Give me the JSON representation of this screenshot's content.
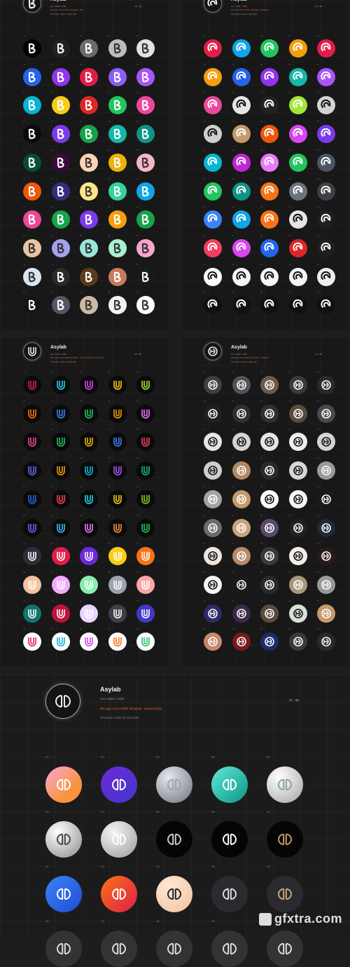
{
  "panels": [
    {
      "id": "p1",
      "title": "Asylab",
      "size": "Icon 1080 x 1080",
      "template": "30 Logo Icon Profile Template - Bix",
      "credit": "Template made by @asylab",
      "range": "01 - 50",
      "glyph": "B"
    },
    {
      "id": "p2",
      "title": "Asylab",
      "size": "Icon 1080 x 1080",
      "template": "30 Logo Icon Profile Template - Gradient",
      "credit": "Template made by @asylab",
      "range": "01 - 50",
      "glyph": "swirl"
    },
    {
      "id": "p3",
      "title": "Asylab",
      "size": "Icon 1080 x 1080",
      "template": "30 Logo Icon Profile Template - Pro & Gradient Combined",
      "credit": "Template made by @asylab",
      "range": "01 - 50",
      "glyph": "U"
    },
    {
      "id": "p4",
      "title": "Asylab",
      "size": "Icon 1080 x 1080",
      "template": "30 Logo Icon Profile Template - Gradient",
      "credit": "Template made by @asylab",
      "range": "01 - 50",
      "glyph": "circ"
    }
  ],
  "p1_colors": [
    "#000",
    "#222",
    "#6c6c6c",
    "#bdbdbd",
    "#e2e2e2",
    "#2563eb",
    "#9333ea",
    "#e11d48",
    "#8b5cf6",
    "#a855f7",
    "#06b6d4",
    "#facc15",
    "#dc2626",
    "#22c55e",
    "#ec4899",
    "#0a0a0a",
    "#7c3aed",
    "#16a34a",
    "#14b8a6",
    "#0d9488",
    "#064e3b",
    "#3b0a3b",
    "#fcd2b6",
    "#eab308",
    "#f5b7c4",
    "#ea580c",
    "#312e81",
    "#fde68a",
    "#34d399",
    "#0ea5e9",
    "#ec4899",
    "#16a34a",
    "#7c3aed",
    "#f59e0b",
    "#16a34a",
    "#e7c4a4",
    "#a5a0ee",
    "#99e6d8",
    "#a7f3d0",
    "#f5a7c9",
    "#dbe4f3",
    "#2a2a2a",
    "#5a3a1a",
    "#c97a5a",
    "#1a1a1a",
    "#151515",
    "#555566",
    "#cbb9a4",
    "#f3f3f3",
    "#ffffff"
  ],
  "p2_colors": [
    "#e11d48",
    "#0ea5e9",
    "#22c55e",
    "#f59e0b",
    "#e11d48",
    "#f59e0b",
    "#2563eb",
    "#9333ea",
    "#14b8a6",
    "#a855f7",
    "#ec4899",
    "#e5e5e5",
    "#222",
    "#a3e635",
    "#d4d4d4",
    "#cfcfcf",
    "#c49a6c",
    "#ea580c",
    "#d946ef",
    "#7c3aed",
    "#06b6d4",
    "#c026d3",
    "#e879f9",
    "#22c55e",
    "#4b5563",
    "#22c55e",
    "#0d9488",
    "#f97316",
    "#6b7280",
    "#3f3f46",
    "#3b82f6",
    "#0ea5e9",
    "#f97316",
    "#e5e5e5",
    "#1f1f1f",
    "#f43f5e",
    "#d946ef",
    "#2563eb",
    "#dc2626",
    "#1f1f1f",
    "#ffffff",
    "#f5f5f5",
    "#f5f5f5",
    "#f5f5f5",
    "#eeeeee",
    "#111",
    "#111",
    "#111",
    "#111",
    "#111"
  ],
  "p3_colors": [
    "#0a0a0a",
    "#0a0a0a",
    "#0a0a0a",
    "#0a0a0a",
    "#0a0a0a",
    "#0a0a0a",
    "#0a0a0a",
    "#0a0a0a",
    "#0a0a0a",
    "#0a0a0a",
    "#0a0a0a",
    "#0a0a0a",
    "#0a0a0a",
    "#0a0a0a",
    "#0a0a0a",
    "#0a0a0a",
    "#0a0a0a",
    "#0a0a0a",
    "#0a0a0a",
    "#0a0a0a",
    "#0a0a0a",
    "#0a0a0a",
    "#0a0a0a",
    "#0a0a0a",
    "#0a0a0a",
    "#0a0a0a",
    "#0a0a0a",
    "#0a0a0a",
    "#0a0a0a",
    "#0a0a0a",
    "#2e2e3a",
    "#e11d48",
    "#6d28d9",
    "#facc15",
    "#f97316",
    "#f2c29e",
    "#f0abfc",
    "#86efac",
    "#9ca3af",
    "#fca5a5",
    "#0f766e",
    "#be123c",
    "#e9d5ff",
    "#3f3f46",
    "#4338ca",
    "#ffffff",
    "#ffffff",
    "#ffffff",
    "#ffffff",
    "#ffffff"
  ],
  "p3_strokes": [
    "#e11d48",
    "#22d3ee",
    "#d946ef",
    "#facc15",
    "#a3e635",
    "#f97316",
    "#3b82f6",
    "#22c55e",
    "#f59e0b",
    "#e879f9",
    "#ec4899",
    "#22c55e",
    "#eab308",
    "#3b82f6",
    "#f43f5e",
    "#6366f1",
    "#f59e0b",
    "#06b6d4",
    "#a855f7",
    "#10b981",
    "#2563eb",
    "#f43f5e",
    "#22d3ee",
    "#facc15",
    "#84cc16",
    "#6366f1",
    "#38bdf8",
    "#e879f9",
    "#fb923c",
    "#22c55e",
    "#ffffff",
    "#ffffff",
    "#ffffff",
    "#ffffff",
    "#ffffff",
    "#ffffff",
    "#ffffff",
    "#ffffff",
    "#ffffff",
    "#ffffff",
    "#ffffff",
    "#ffffff",
    "#ffffff",
    "#ffffff",
    "#ffffff",
    "#e11d48",
    "#06b6d4",
    "#d946ef",
    "#f97316",
    "#22c55e"
  ],
  "p4_colors": [
    "#3f3f46",
    "#52525b",
    "#6b5a4a",
    "#3a3a3a",
    "#2a2a2a",
    "#1f1f1f",
    "#2f2f2f",
    "#303030",
    "#5a4a3a",
    "#4a4a4a",
    "#e5e5e5",
    "#d4d4d4",
    "#e5e5e5",
    "#eeeeee",
    "#d4d4d4",
    "#cfcfcf",
    "#b08862",
    "#2a2a2a",
    "#d6d6d6",
    "#9a9a9a",
    "#a3a3a3",
    "#c49a6c",
    "#ffffff",
    "#f5f5f5",
    "#1a1a1a",
    "#6b6b6b",
    "#c9a57a",
    "#5a4a6a",
    "#222",
    "#1e2a3a",
    "#f0e5dd",
    "#b68a6a",
    "#3a3a3a",
    "#f5ede6",
    "#2a1a1a",
    "#f5f5f5",
    "#1a1a1a",
    "#2a2a2a",
    "#a8987a",
    "#9a9a9a",
    "#2e2a6a",
    "#3a2a4a",
    "#5a4a3a",
    "#d8e0d8",
    "#c49a6c",
    "#c8866a",
    "#7a1a1a",
    "#1e2a6a",
    "#3a3a3a",
    "#2a2a2a"
  ],
  "hero": {
    "title": "Asylab",
    "size": "Icon 1024 x 1024",
    "template": "25 Logo Icon Profile Template - Bonus Extra",
    "credit": "Template made by @asylab",
    "range": "01 - 50"
  },
  "big_icons": [
    {
      "n": "01.",
      "bg": "linear-gradient(135deg,#f9a8d4,#fb923c 70%)",
      "mark": "#fff"
    },
    {
      "n": "02.",
      "bg": "linear-gradient(135deg,#6d28d9,#4338ca)",
      "mark": "#fff"
    },
    {
      "n": "03.",
      "bg": "radial-gradient(circle at 35% 30%,#e5e7eb,#6b7280)",
      "mark": "#9ca3af"
    },
    {
      "n": "04.",
      "bg": "linear-gradient(135deg,#5eead4,#0d9488)",
      "mark": "#fff"
    },
    {
      "n": "05.",
      "bg": "radial-gradient(circle at 35% 30%,#ffffff,#a3a3a3)",
      "mark": "#8aa0a0"
    },
    {
      "n": "06.",
      "bg": "radial-gradient(circle at 35% 30%,#ffffff,#8a8a8a)",
      "mark": "#444"
    },
    {
      "n": "07.",
      "bg": "radial-gradient(circle at 35% 30%,#f5f5f5,#9a9a9a)",
      "mark": "#fff"
    },
    {
      "n": "08.",
      "bg": "#050505",
      "mark": "#cccccc"
    },
    {
      "n": "09.",
      "bg": "#050505",
      "mark": "#ffffff"
    },
    {
      "n": "10.",
      "bg": "#050505",
      "mark": "#c49a6c"
    },
    {
      "n": "11.",
      "bg": "linear-gradient(135deg,#3b82f6,#1d4ed8)",
      "mark": "#fff"
    },
    {
      "n": "12.",
      "bg": "linear-gradient(135deg,#f97316,#e11d48)",
      "mark": "#fff"
    },
    {
      "n": "13.",
      "bg": "radial-gradient(circle at 35% 30%,#fde7d4,#f2c29e)",
      "mark": "#222"
    },
    {
      "n": "14.",
      "bg": "#2a2a30",
      "mark": "#ddd"
    },
    {
      "n": "15.",
      "bg": "#2a2a30",
      "mark": "#c9a57a"
    },
    {
      "n": "16.",
      "bg": "#333",
      "mark": "#ddd"
    },
    {
      "n": "17.",
      "bg": "#333",
      "mark": "#ddd"
    },
    {
      "n": "18.",
      "bg": "#333",
      "mark": "#ddd"
    },
    {
      "n": "19.",
      "bg": "#333",
      "mark": "#ddd"
    },
    {
      "n": "20.",
      "bg": "#333",
      "mark": "#ddd"
    }
  ],
  "watermark": "gfxtra.com"
}
